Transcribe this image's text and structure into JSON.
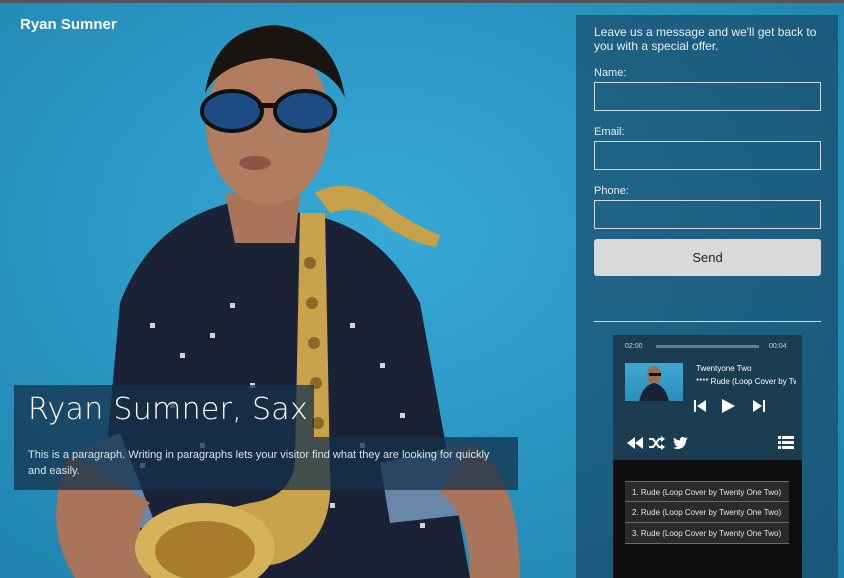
{
  "site": {
    "title": "Ryan Sumner"
  },
  "hero": {
    "title": "Ryan Sumner, Sax",
    "paragraph": "This is a paragraph. Writing in paragraphs lets your visitor find what they are looking for quickly and easily."
  },
  "contact_form": {
    "intro": "Leave us a message and we'll get back to you with a special offer.",
    "name_label": "Name:",
    "name_value": "",
    "email_label": "Email:",
    "email_value": "",
    "phone_label": "Phone:",
    "phone_value": "",
    "send_label": "Send"
  },
  "player": {
    "time_elapsed": "02:00",
    "time_total": "00:04",
    "progress_fraction": 0.0,
    "artist": "Twentyone Two",
    "track_title": "**** Rude (Loop Cover by Twenty One Two)",
    "icons": [
      "prev-icon",
      "play-icon",
      "next-icon",
      "rewind-icon",
      "shuffle-icon",
      "twitter-icon",
      "playlist-icon"
    ],
    "playlist": [
      "1. Rude (Loop Cover by Twenty One Two)",
      "2. Rude (Loop Cover by Twenty One Two)",
      "3. Rude (Loop Cover by Twenty One Two)"
    ]
  },
  "colors": {
    "background": "#2e9bc7",
    "panel": "#1c4a66",
    "player_top": "#1a3d52",
    "player_body": "#0e0e0e",
    "button": "#d9d9d9"
  }
}
